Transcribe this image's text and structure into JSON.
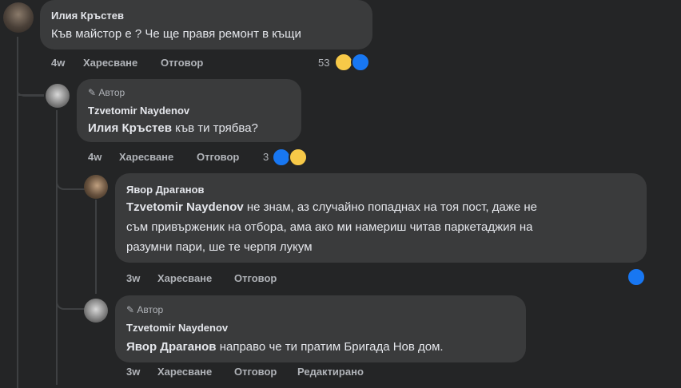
{
  "comments": [
    {
      "author": "Илия Кръстев",
      "text": "Къв майстор е ? Че ще правя ремонт в къщи",
      "time": "4w",
      "like_label": "Харесване",
      "reply_label": "Отговор",
      "reaction_count": "53"
    },
    {
      "badge": "Автор",
      "author": "Tzvetomir Naydenov",
      "mention": "Илия Кръстев",
      "text": "къв ти трябва?",
      "time": "4w",
      "like_label": "Харесване",
      "reply_label": "Отговор",
      "reaction_count": "3"
    },
    {
      "author": "Явор Драганов",
      "mention": "Tzvetomir Naydenov",
      "text_line1": "не знам, аз случайно попаднах на тоя пост, даже не",
      "text_line2": "съм привърженик на отбора, ама ако ми намериш читав паркетаджия на",
      "text_line3": "разумни пари, ше те черпя лукум",
      "time": "3w",
      "like_label": "Харесване",
      "reply_label": "Отговор"
    },
    {
      "badge": "Автор",
      "author": "Tzvetomir Naydenov",
      "mention": "Явор Драганов",
      "text": "направо че ти пратим Бригада Нов дом.",
      "time": "3w",
      "like_label": "Харесване",
      "reply_label": "Отговор",
      "edited_label": "Редактирано"
    }
  ],
  "colors": {
    "background": "#242526",
    "bubble": "#3a3b3c",
    "like": "#1877f2",
    "haha": "#f7c948"
  }
}
